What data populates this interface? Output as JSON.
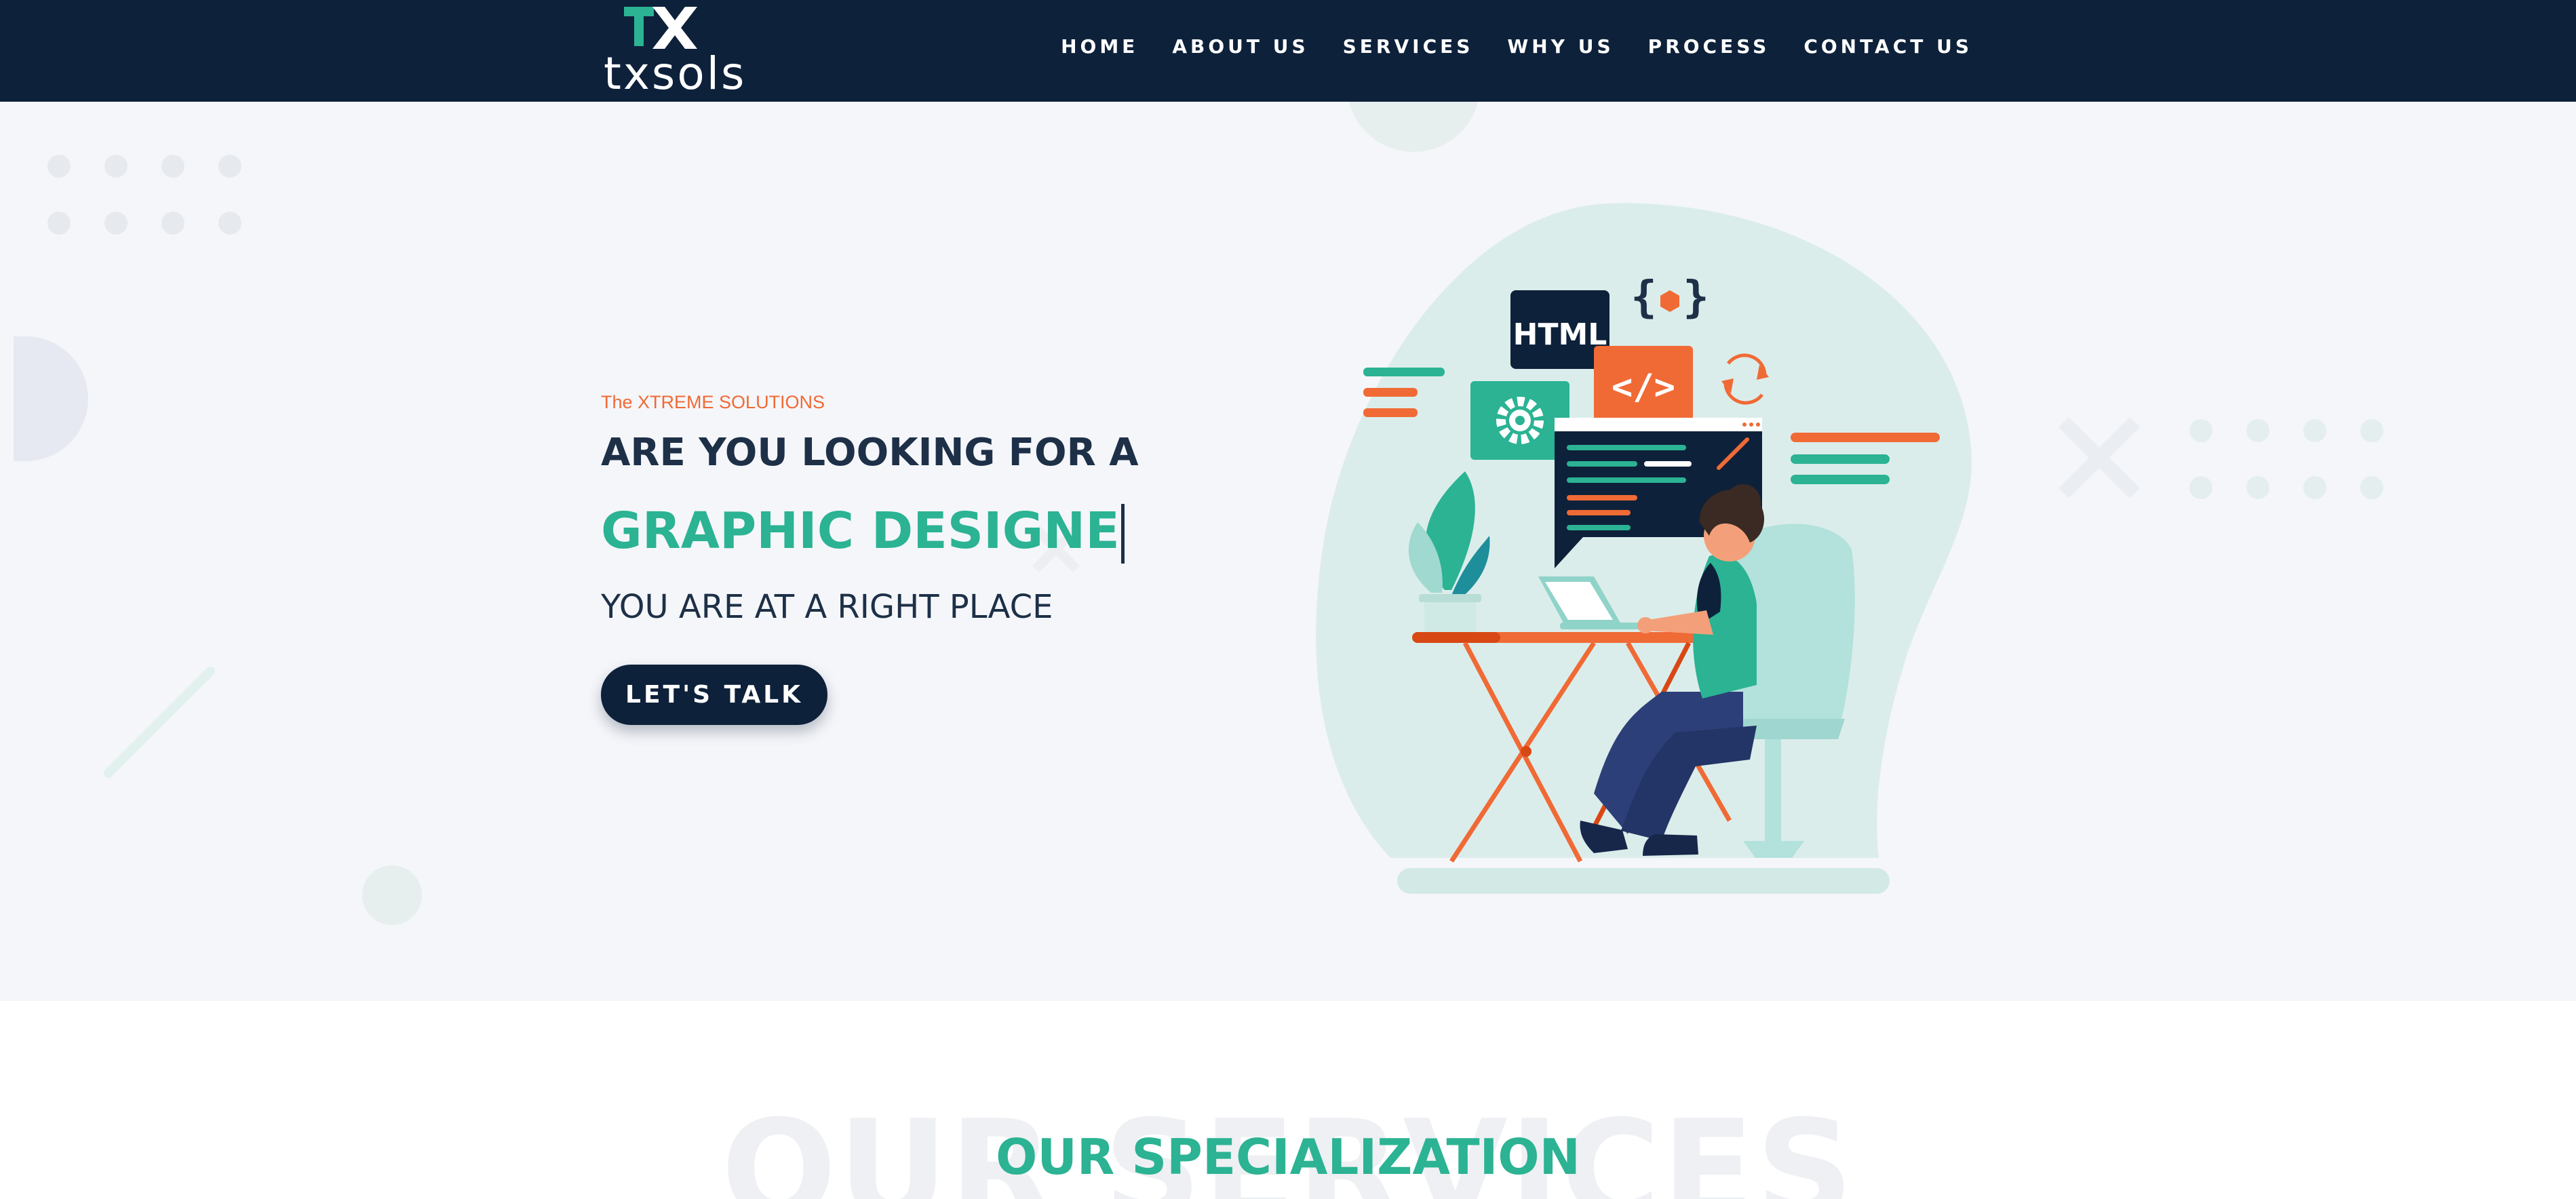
{
  "brand": {
    "name": "txsols"
  },
  "nav": {
    "items": [
      {
        "label": "HOME"
      },
      {
        "label": "ABOUT US"
      },
      {
        "label": "SERVICES"
      },
      {
        "label": "WHY US"
      },
      {
        "label": "PROCESS"
      },
      {
        "label": "CONTACT US"
      }
    ]
  },
  "hero": {
    "tagline": "The XTREME SOLUTIONS",
    "headline_1": "ARE YOU LOOKING FOR A",
    "headline_2": "GRAPHIC DESIGNE",
    "headline_3": "YOU ARE AT A RIGHT PLACE",
    "cta_label": "LET'S TALK",
    "illustration": {
      "badge_html": "HTML",
      "badge_code": "</>",
      "badge_braces": "{ }"
    }
  },
  "services": {
    "watermark": "OUR SERVICES",
    "title": "OUR SPECIALIZATION"
  },
  "colors": {
    "navy": "#0e213a",
    "teal": "#2bb393",
    "orange": "#f06a35",
    "text_dark": "#1d3047",
    "hero_bg": "#f5f6fa"
  }
}
